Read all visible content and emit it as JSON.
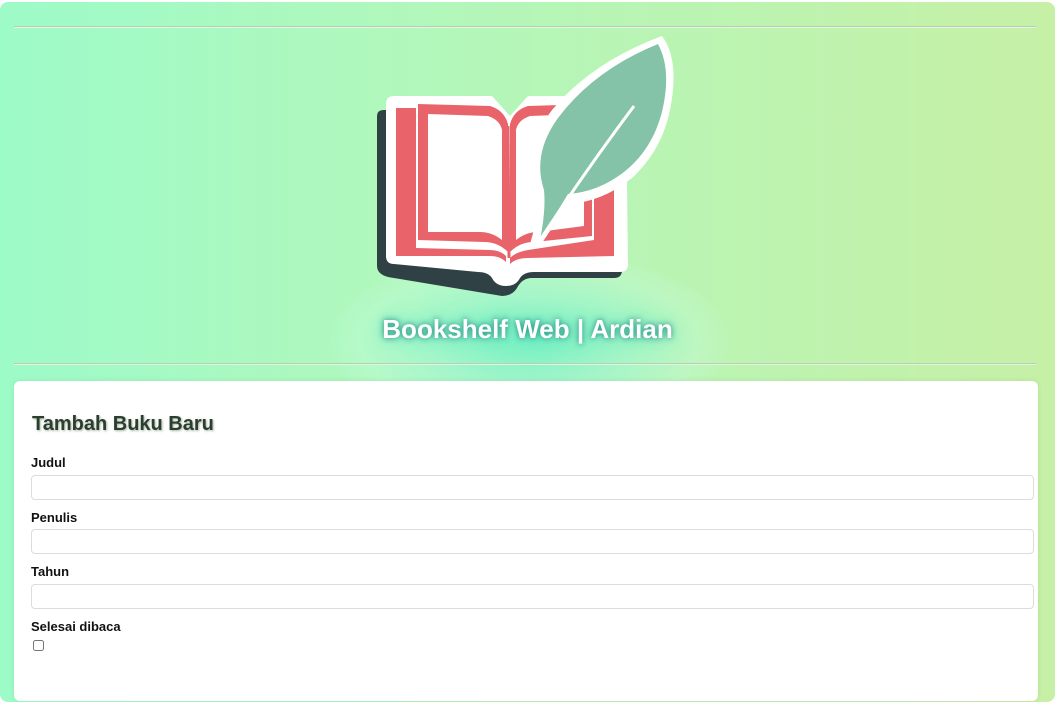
{
  "header": {
    "title": "Bookshelf Web | Ardian",
    "logo_icon": "book-with-quill-icon"
  },
  "form": {
    "title": "Tambah Buku Baru",
    "fields": [
      {
        "label": "Judul",
        "value": "",
        "placeholder": ""
      },
      {
        "label": "Penulis",
        "value": "",
        "placeholder": ""
      },
      {
        "label": "Tahun",
        "value": "",
        "placeholder": ""
      }
    ],
    "checkbox": {
      "label": "Selesai dibaca",
      "checked": false
    }
  },
  "colors": {
    "background_left": "#9dfbc8",
    "background_right": "#c6f0a6",
    "book_red": "#e8646a",
    "quill_green": "#84c3a8",
    "shadow_dark": "#2f4144"
  }
}
